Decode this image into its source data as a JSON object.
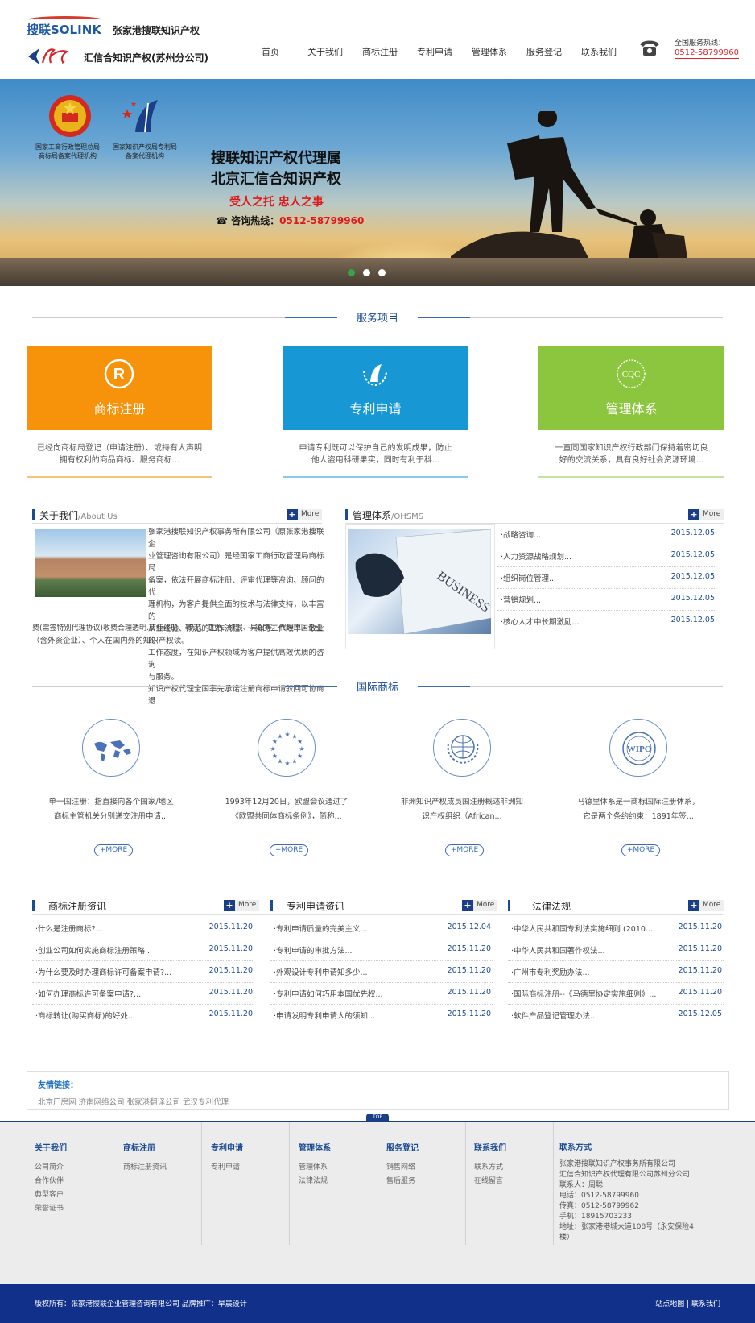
{
  "header": {
    "logo1": "搜联SOLINK",
    "logo1_name": "张家港搜联知识产权",
    "logo2_name": "汇信合知识产权(苏州分公司)",
    "nav": [
      "首页",
      "关于我们",
      "商标注册",
      "专利申请",
      "管理体系",
      "服务登记",
      "联系我们"
    ],
    "hotline_label": "全国服务热线：",
    "hotline": "0512-58799960"
  },
  "banner": {
    "badge1": [
      "国家工商行政管理总局",
      "商标局备案代理机构"
    ],
    "badge2": [
      "国家知识产权局专利局",
      "备案代理机构"
    ],
    "title1": "搜联知识产权代理属",
    "title2": "北京汇信合知识产权",
    "slogan": "受人之托  忠人之事",
    "hot_label": "咨询热线：",
    "hot_num": "0512-58799960"
  },
  "services": {
    "title": "服务项目",
    "items": [
      {
        "label": "商标注册",
        "desc": [
          "已经向商标局登记（申请注册）、或持有人声明",
          "拥有权利的商品商标、服务商标..."
        ],
        "color": "#f7920b"
      },
      {
        "label": "专利申请",
        "desc": [
          "申请专利既可以保护自己的发明成果，防止",
          "他人盗用科研果实，同时有利于科..."
        ],
        "color": "#1798d4"
      },
      {
        "label": "管理体系",
        "desc": [
          "一直同国家知识产权行政部门保持着密切良",
          "好的交流关系，具有良好社会资源环境..."
        ],
        "color": "#8cc63e"
      }
    ]
  },
  "about": {
    "title": "关于我们",
    "title_en": "/About Us",
    "more": "More",
    "lines_right": [
      "张家港搜联知识产权事务所有限公司（原张家港搜联企",
      "业管理咨询有限公司）是经国家工商行政管理局商标局",
      "备案，依法开展商标注册、评审代理等咨询、顾问的代",
      "理机构，为客户提供全面的技术与法律支持，以丰富的",
      "从业经验、规范的工作流程、一流的工作效率、敬业的",
      "工作态度，在知识产权领域为客户提供高效优质的咨询",
      "与服务。",
      "知识产权代理全国率先承诺注册商标申请驳回可协商退"
    ],
    "lines_full": [
      "费(需签特别代理协议)收费合理透明.商标注册、转让、变更、续展、异议等。代理中国企业",
      "（含外资企业）、个人在国内外的知识产权读。"
    ]
  },
  "ohsms": {
    "title": "管理体系",
    "title_en": "/OHSMS",
    "more": "More",
    "items": [
      {
        "t": "·战略咨询...",
        "d": "2015.12.05"
      },
      {
        "t": "·人力资源战略规划...",
        "d": "2015.12.05"
      },
      {
        "t": "·组织岗位管理...",
        "d": "2015.12.05"
      },
      {
        "t": "·营销规划...",
        "d": "2015.12.05"
      },
      {
        "t": "·核心人才中长期激励...",
        "d": "2015.12.05"
      }
    ]
  },
  "intl": {
    "title": "国际商标",
    "more": "+MORE",
    "items": [
      {
        "desc": [
          "单一国注册：指直接向各个国家/地区",
          "商标主管机关分别递交注册申请..."
        ],
        "icon": "world-map-icon"
      },
      {
        "desc": [
          "1993年12月20日，欧盟会议通过了",
          "《欧盟共同体商标条例》，简称..."
        ],
        "icon": "eu-stars-icon"
      },
      {
        "desc": [
          "非洲知识产权成员国注册概述非洲知",
          "识产权组织（African..."
        ],
        "icon": "un-emblem-icon"
      },
      {
        "desc": [
          "马德里体系是一商标国际注册体系，",
          "它是两个条约约束：1891年签..."
        ],
        "icon": "wipo-icon"
      }
    ]
  },
  "news": [
    {
      "title": "商标注册资讯",
      "more": "More",
      "items": [
        {
          "t": "·什么是注册商标?...",
          "d": "2015.11.20"
        },
        {
          "t": "·创业公司如何实施商标注册策略...",
          "d": "2015.11.20"
        },
        {
          "t": "·为什么要及时办理商标许可备案申请?...",
          "d": "2015.11.20"
        },
        {
          "t": "·如何办理商标许可备案申请?...",
          "d": "2015.11.20"
        },
        {
          "t": "·商标转让(购买商标)的好处...",
          "d": "2015.11.20"
        }
      ]
    },
    {
      "title": "专利申请资讯",
      "more": "More",
      "items": [
        {
          "t": "·专利申请质量的完美主义...",
          "d": "2015.12.04"
        },
        {
          "t": "·专利申请的审批方法...",
          "d": "2015.11.20"
        },
        {
          "t": "·外观设计专利申请知多少...",
          "d": "2015.11.20"
        },
        {
          "t": "·专利申请如何巧用本国优先权...",
          "d": "2015.11.20"
        },
        {
          "t": "·申请发明专利申请人的须知...",
          "d": "2015.11.20"
        }
      ]
    },
    {
      "title": "法律法规",
      "more": "More",
      "items": [
        {
          "t": "·中华人民共和国专利法实施细则 (2010...",
          "d": "2015.11.20"
        },
        {
          "t": "·中华人民共和国著作权法...",
          "d": "2015.11.20"
        },
        {
          "t": "·广州市专利奖励办法...",
          "d": "2015.11.20"
        },
        {
          "t": "·国际商标注册--《马德里协定实施细则》...",
          "d": "2015.11.20"
        },
        {
          "t": "·软件产品登记管理办法...",
          "d": "2015.12.05"
        }
      ]
    }
  ],
  "friends": {
    "title": "友情链接：",
    "links": "北京厂房网 济南网络公司 张家港翻译公司 武汉专利代理"
  },
  "footer": {
    "top": "TOP",
    "cols": [
      {
        "h": "关于我们",
        "items": [
          "公司简介",
          "合作伙伴",
          "典型客户",
          "荣誉证书"
        ]
      },
      {
        "h": "商标注册",
        "items": [
          "商标注册资讯"
        ]
      },
      {
        "h": "专利申请",
        "items": [
          "专利申请"
        ]
      },
      {
        "h": "管理体系",
        "items": [
          "管理体系",
          "法律法规"
        ]
      },
      {
        "h": "服务登记",
        "items": [
          "销售网络",
          "售后服务"
        ]
      },
      {
        "h": "联系我们",
        "items": [
          "联系方式",
          "在线留言"
        ]
      }
    ],
    "contact": {
      "h": "联系方式",
      "lines": [
        "张家港搜联知识产权事务所有限公司",
        "汇信合知识产权代理有限公司苏州分公司",
        "联系人：周聪",
        "电话：0512-58799960",
        "传真：0512-58799962",
        "手机：18915703233",
        "地址：张家港港城大道108号（永安保险4",
        "楼）"
      ]
    },
    "copyright": "版权所有：张家港搜联企业管理咨询有限公司 品牌推广：早晨设计",
    "right": "站点地图 | 联系我们"
  }
}
